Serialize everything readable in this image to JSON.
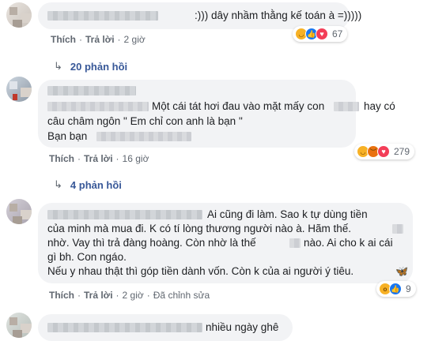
{
  "comments": [
    {
      "text": ":))) dây nhầm thằng kế toán à =)))))",
      "actions": {
        "like": "Thích",
        "reply": "Trả lời",
        "time": "2 giờ"
      },
      "reactions": {
        "icons": [
          "haha-icon",
          "like-icon",
          "love-icon"
        ],
        "count": "67"
      },
      "replies": "20 phản hồi"
    },
    {
      "lines": [
        "Một cái tát hơi đau vào mặt mấy con",
        "hay có",
        "câu châm ngôn \" Em chỉ con anh là bạn \"",
        "Bạn bạn"
      ],
      "actions": {
        "like": "Thích",
        "reply": "Trả lời",
        "time": "16 giờ"
      },
      "reactions": {
        "icons": [
          "haha-icon",
          "angry-icon",
          "love-icon"
        ],
        "count": "279"
      },
      "replies": "4 phản hồi"
    },
    {
      "lines": [
        "Ai cũng đi làm. Sao k tự dùng tiền",
        "của minh mà mua đi. K có tí lòng thương người nào à. Hãm thế.",
        "nhờ. Vay thì trả đàng hoàng. Còn nhờ là thế",
        "nào. Ai cho k ai cái",
        "gì bh. Con ngáo.",
        "Nếu y nhau thật thì góp tiền dành vốn. Còn k của ai người ý tiêu."
      ],
      "actions": {
        "like": "Thích",
        "reply": "Trả lời",
        "time": "2 giờ",
        "edited": "Đã chỉnh sửa"
      },
      "reactions": {
        "icons": [
          "wow-icon",
          "like-icon"
        ],
        "count": "9"
      }
    },
    {
      "text": "nhiều ngày ghê"
    }
  ],
  "colors": {
    "link": "#385898",
    "meta": "#606770",
    "bubble": "#f2f3f5"
  }
}
